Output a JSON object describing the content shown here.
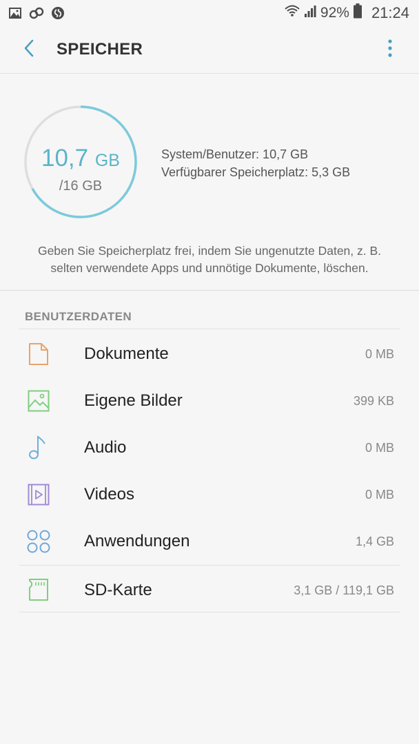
{
  "status_bar": {
    "battery_percent": "92%",
    "time": "21:24",
    "left_icons": [
      "image-icon",
      "link-icon",
      "shazam-icon"
    ],
    "right_icons": [
      "wifi-icon",
      "signal-icon",
      "battery-icon"
    ]
  },
  "app_bar": {
    "title": "SPEICHER",
    "back_icon": "chevron-left-icon",
    "menu_icon": "more-vertical-icon",
    "accent_color": "#4a9fc0"
  },
  "storage": {
    "used_value": "10,7",
    "used_unit": "GB",
    "total": "/16 GB",
    "used_fraction": 0.669,
    "ring_color": "#7ccadb",
    "ring_track_color": "#dedede",
    "system_user": "System/Benutzer: 10,7 GB",
    "available": "Verfügbarer Speicherplatz: 5,3 GB",
    "hint": "Geben Sie Speicherplatz frei, indem Sie ungenutzte Daten, z. B. selten verwendete Apps und unnötige Dokumente, löschen."
  },
  "section": {
    "header": "BENUTZERDATEN",
    "items": [
      {
        "label": "Dokumente",
        "size": "0 MB",
        "icon": "document-icon",
        "color": "#e8a46a"
      },
      {
        "label": "Eigene Bilder",
        "size": "399 KB",
        "icon": "image-icon",
        "color": "#7fcf7f"
      },
      {
        "label": "Audio",
        "size": "0 MB",
        "icon": "music-note-icon",
        "color": "#6fb0d8"
      },
      {
        "label": "Videos",
        "size": "0 MB",
        "icon": "video-icon",
        "color": "#a28ad6"
      },
      {
        "label": "Anwendungen",
        "size": "1,4 GB",
        "icon": "apps-grid-icon",
        "color": "#6fa8d8"
      }
    ],
    "sd_card": {
      "label": "SD-Karte",
      "size": "3,1 GB / 119,1 GB",
      "icon": "sd-card-icon",
      "color": "#7fcf7f"
    }
  }
}
